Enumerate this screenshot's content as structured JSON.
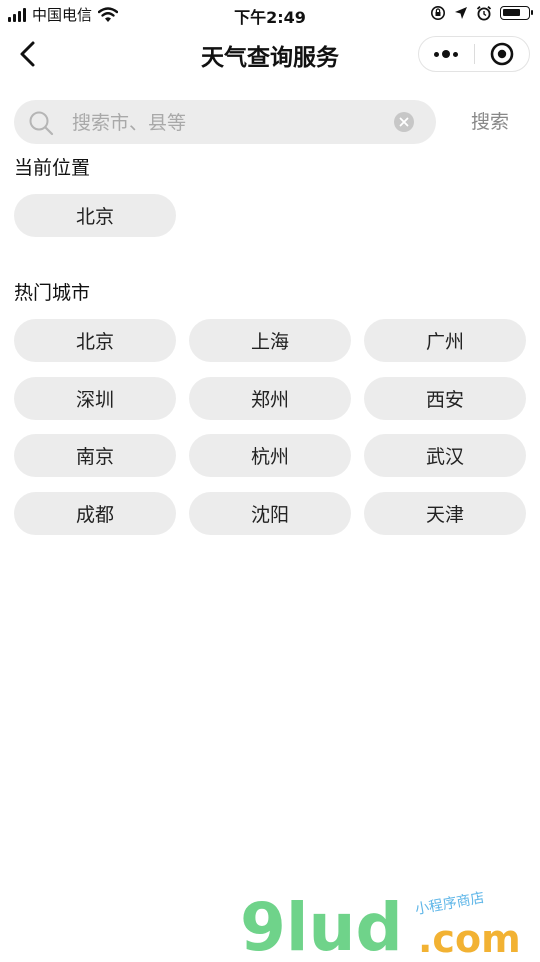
{
  "status_bar": {
    "carrier": "中国电信",
    "time": "下午2:49",
    "battery_level": 0.75,
    "icons": [
      "signal-icon",
      "wifi-icon",
      "orientation-lock-icon",
      "location-icon",
      "alarm-icon",
      "battery-icon"
    ]
  },
  "nav": {
    "title": "天气查询服务",
    "back_icon": "chevron-left-icon",
    "more_icon": "more-dots-icon",
    "close_icon": "target-icon"
  },
  "search": {
    "placeholder": "搜索市、县等",
    "value": "",
    "button_label": "搜索"
  },
  "current_location": {
    "title": "当前位置",
    "city": "北京"
  },
  "hot_cities": {
    "title": "热门城市",
    "cities": [
      "北京",
      "上海",
      "广州",
      "深圳",
      "郑州",
      "西安",
      "南京",
      "杭州",
      "武汉",
      "成都",
      "沈阳",
      "天津"
    ]
  },
  "watermark": {
    "brand": "9lud",
    "domain": ".com",
    "slogan": "小程序商店",
    "colors": {
      "brand": "#6fd38a",
      "domain": "#f2b233",
      "accent": "#5fb6e8"
    }
  },
  "colors": {
    "chip_bg": "#ececec",
    "search_bg": "#ececec",
    "muted_text": "#888888"
  }
}
